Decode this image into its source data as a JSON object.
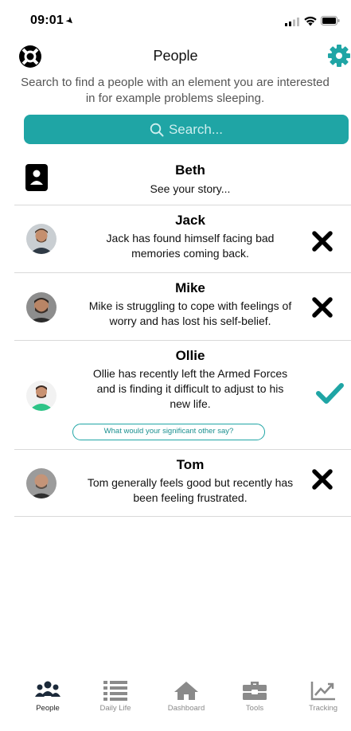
{
  "status_bar": {
    "time": "09:01"
  },
  "header": {
    "title": "People"
  },
  "intro": {
    "line1": "Search to find a people with an element you are interested",
    "line2": "in for example problems sleeping."
  },
  "search": {
    "placeholder": "Search..."
  },
  "self": {
    "name": "Beth",
    "subtitle": "See your story..."
  },
  "people": [
    {
      "name": "Jack",
      "line1": "Jack has found himself facing bad",
      "line2": "memories coming back.",
      "status": "dismissed"
    },
    {
      "name": "Mike",
      "line1": "Mike is struggling to cope with feelings of",
      "line2": "worry and has lost his self-belief.",
      "status": "dismissed"
    },
    {
      "name": "Ollie",
      "line1": "Ollie has recently left the Armed Forces",
      "line2": "and is finding it difficult to adjust to his",
      "line3": "new life.",
      "status": "selected",
      "prompt": "What would your significant other say?"
    },
    {
      "name": "Tom",
      "line1": "Tom generally feels good but recently has",
      "line2": "been feeling frustrated.",
      "status": "dismissed"
    }
  ],
  "tabs": [
    {
      "label": "People",
      "icon": "people-icon",
      "active": true
    },
    {
      "label": "Daily Life",
      "icon": "list-icon",
      "active": false
    },
    {
      "label": "Dashboard",
      "icon": "home-icon",
      "active": false
    },
    {
      "label": "Tools",
      "icon": "toolbox-icon",
      "active": false
    },
    {
      "label": "Tracking",
      "icon": "chart-icon",
      "active": false
    }
  ],
  "colors": {
    "accent": "#1fa5a5",
    "check": "#1fa5a5",
    "cross": "#000000"
  }
}
